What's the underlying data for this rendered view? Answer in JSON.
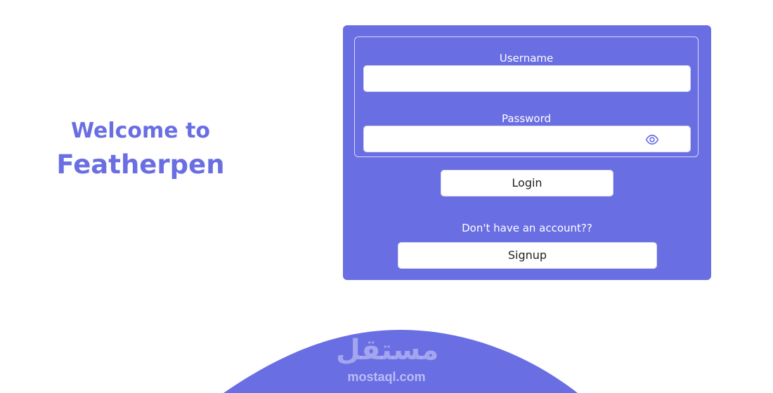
{
  "theme": {
    "accent": "#6a6ee3",
    "surface": "#ffffff"
  },
  "hero": {
    "line1": "Welcome to",
    "line2": "Featherpen"
  },
  "login_form": {
    "username_label": "Username",
    "username_value": "",
    "password_label": "Password",
    "password_value": "",
    "password_toggle_icon": "eye-icon",
    "login_label": "Login",
    "signup_prompt": "Don't have an account??",
    "signup_label": "Signup"
  },
  "watermark": {
    "arabic": "مستقل",
    "latin": "mostaql.com"
  }
}
